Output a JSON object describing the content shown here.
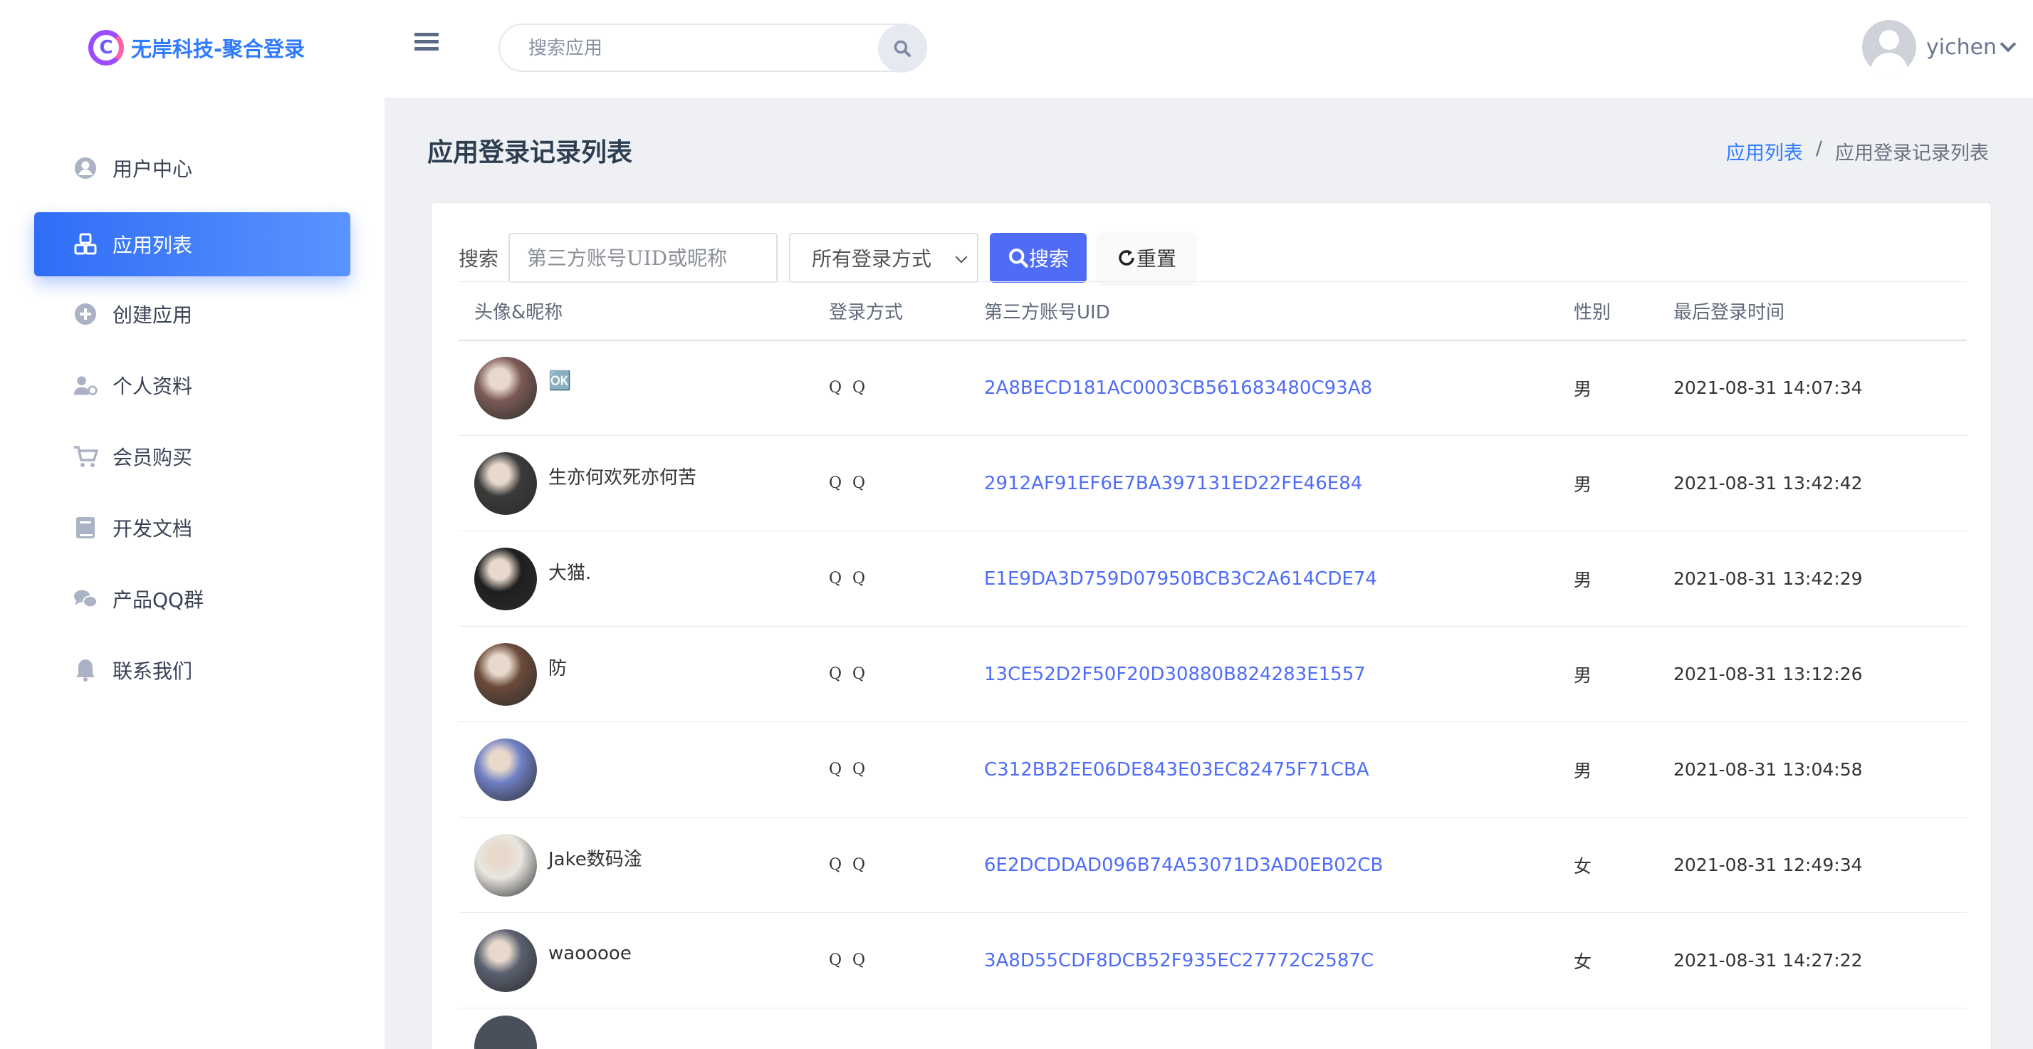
{
  "brand": {
    "title": "无岸科技-聚合登录",
    "logo_letter": "C"
  },
  "header": {
    "search_placeholder": "搜索应用",
    "username": "yichen"
  },
  "sidebar": {
    "items": [
      {
        "label": "用户中心",
        "icon": "user-circle-icon"
      },
      {
        "label": "应用列表",
        "icon": "cubes-icon",
        "active": true
      },
      {
        "label": "创建应用",
        "icon": "plus-circle-icon"
      },
      {
        "label": "个人资料",
        "icon": "user-gear-icon"
      },
      {
        "label": "会员购买",
        "icon": "cart-icon"
      },
      {
        "label": "开发文档",
        "icon": "book-icon"
      },
      {
        "label": "产品QQ群",
        "icon": "chat-icon"
      },
      {
        "label": "联系我们",
        "icon": "bell-icon"
      }
    ]
  },
  "page": {
    "title": "应用登录记录列表",
    "breadcrumb": {
      "link": "应用列表",
      "separator": "/",
      "current": "应用登录记录列表"
    }
  },
  "filters": {
    "label": "搜索",
    "input_placeholder": "第三方账号UID或昵称",
    "select_value": "所有登录方式",
    "search_button": "搜索",
    "reset_button": "重置"
  },
  "table": {
    "headers": [
      "头像&昵称",
      "登录方式",
      "第三方账号UID",
      "性别",
      "最后登录时间"
    ],
    "rows": [
      {
        "nickname": "🆗",
        "method": "Q Q",
        "uid": "2A8BECD181AC0003CB561683480C93A8",
        "gender": "男",
        "time": "2021-08-31 14:07:34",
        "avatar_color": "#7a5a55"
      },
      {
        "nickname": "生亦何欢死亦何苦",
        "method": "Q Q",
        "uid": "2912AF91EF6E7BA397131ED22FE46E84",
        "gender": "男",
        "time": "2021-08-31 13:42:42",
        "avatar_color": "#3a3a3a"
      },
      {
        "nickname": "大猫.",
        "method": "Q Q",
        "uid": "E1E9DA3D759D07950BCB3C2A614CDE74",
        "gender": "男",
        "time": "2021-08-31 13:42:29",
        "avatar_color": "#1f1f1f"
      },
      {
        "nickname": "防",
        "method": "Q Q",
        "uid": "13CE52D2F50F20D30880B824283E1557",
        "gender": "男",
        "time": "2021-08-31 13:12:26",
        "avatar_color": "#6b4a3a"
      },
      {
        "nickname": "",
        "method": "Q Q",
        "uid": "C312BB2EE06DE843E03EC82475F71CBA",
        "gender": "男",
        "time": "2021-08-31 13:04:58",
        "avatar_color": "#6f7fc4"
      },
      {
        "nickname": "Jake数码淦",
        "method": "Q Q",
        "uid": "6E2DCDDAD096B74A53071D3AD0EB02CB",
        "gender": "女",
        "time": "2021-08-31 12:49:34",
        "avatar_color": "#e9e6e0"
      },
      {
        "nickname": "waooooe",
        "method": "Q Q",
        "uid": "3A8D55CDF8DCB52F935EC27772C2587C",
        "gender": "女",
        "time": "2021-08-31 14:27:22",
        "avatar_color": "#5a6070"
      }
    ]
  },
  "colors": {
    "accent": "#2f6df6",
    "link": "#4f6cf7",
    "background": "#eef0f4"
  }
}
